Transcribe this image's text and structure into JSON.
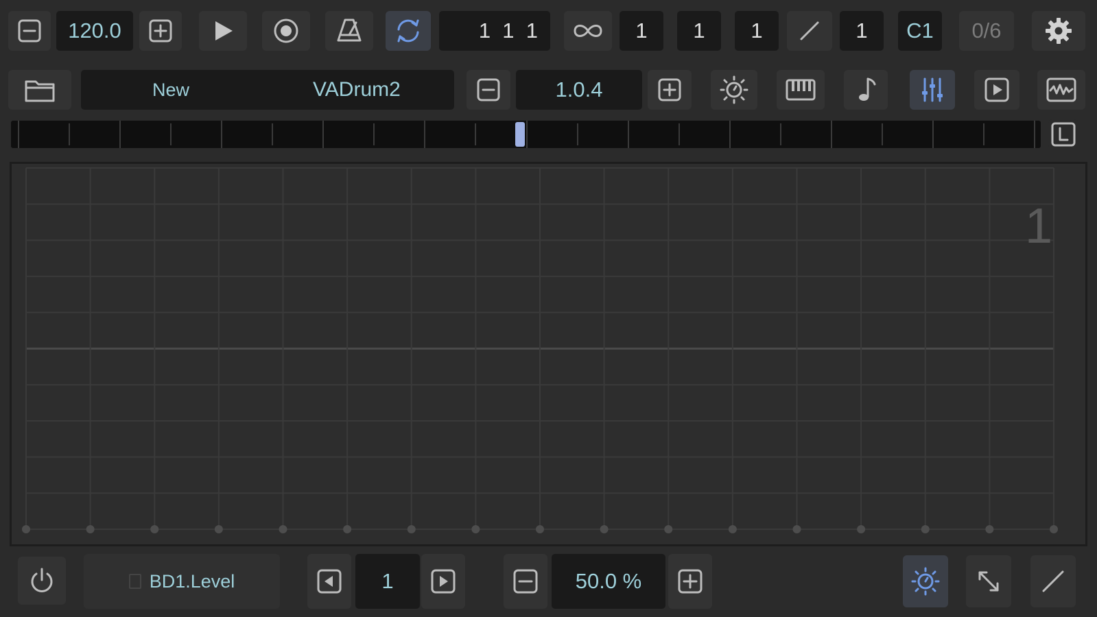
{
  "transport": {
    "tempo": "120.0",
    "position": "1  1  1",
    "loop_values": [
      "1",
      "1",
      "1"
    ],
    "step_value": "1",
    "note": "C1",
    "counter": "0/6"
  },
  "preset": {
    "new_label": "New",
    "name": "VADrum2",
    "version": "1.0.4"
  },
  "timeline": {
    "playhead_position": 0.49
  },
  "editor": {
    "pattern_number": "1",
    "columns": 16,
    "rows": 10
  },
  "footer": {
    "parameter": "BD1.Level",
    "step": "1",
    "value": "50.0 %"
  },
  "colors": {
    "background": "#2b2b2b",
    "field": "#1a1a1a",
    "accent_blue": "#6f9ae6",
    "value_teal": "#9ed0da",
    "playhead": "#9fb1e3"
  },
  "icons": [
    "minus-icon",
    "plus-icon",
    "play-icon",
    "record-icon",
    "metronome-icon",
    "loop-icon",
    "infinity-icon",
    "slash-icon",
    "gear-icon",
    "folder-icon",
    "sun-icon",
    "piano-icon",
    "note-icon",
    "mixer-icon",
    "play-box-icon",
    "waveform-icon",
    "lock-icon",
    "power-icon",
    "arrow-left-icon",
    "arrow-right-icon",
    "expand-icon",
    "pencil-icon"
  ]
}
